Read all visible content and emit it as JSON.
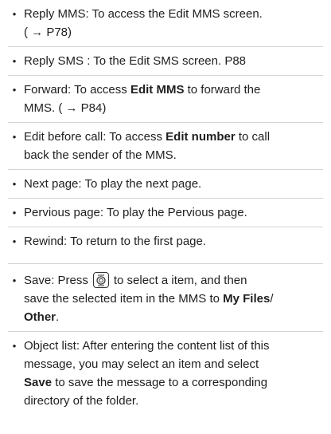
{
  "items": [
    {
      "pre": "Reply MMS: To access the Edit MMS screen.",
      "line2": "( → P78)"
    },
    {
      "pre": "Reply SMS : To the Edit SMS screen. P88"
    },
    {
      "pre": "Forward: To access ",
      "bold": "Edit MMS",
      "post": " to forward the",
      "line2": "MMS. ( → P84)"
    },
    {
      "pre": "Edit before call: To access ",
      "bold": "Edit number",
      "post": " to call",
      "line2": "back the sender of the MMS."
    },
    {
      "pre": "Next page: To play the next page."
    },
    {
      "pre": "Pervious page: To play the Pervious page."
    },
    {
      "pre": "Rewind: To return to the first page."
    },
    {
      "pre": "Save: Press",
      "post": "to select a item, and then",
      "line2a": "save the selected item in the MMS to ",
      "bold2": "My Files",
      "line2b": "/",
      "bold3": "Other",
      "line3b": "."
    },
    {
      "pre": "Object list: After entering the content list of this",
      "line2": "message, you may select an item and select",
      "bold3": "Save",
      "line3b": " to save the message to a corresponding",
      "line4": "directory of the folder."
    }
  ],
  "icons": {
    "center_key": "center-select-key-icon"
  }
}
